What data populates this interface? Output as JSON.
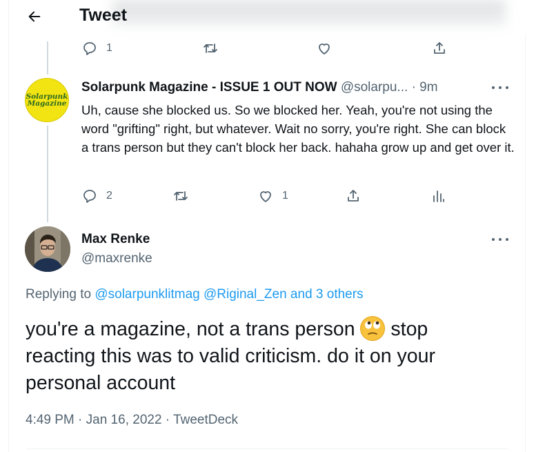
{
  "header": {
    "title": "Tweet",
    "back_icon": "arrow-left-icon"
  },
  "top_actions": {
    "reply_count": "1"
  },
  "reply_tweet": {
    "avatar_text_line1": "Solarpunk",
    "avatar_text_line2": "Magazine",
    "name": "Solarpunk Magazine - ISSUE 1 OUT NOW",
    "handle": "@solarpu...",
    "time": "· 9m",
    "text": "Uh, cause she blocked us. So we blocked her. Yeah, you're not using the word \"grifting\" right, but whatever. Wait no sorry, you're right. She can block a trans person but they can't block her back. hahaha grow up and get over it.",
    "reply_count": "2",
    "like_count": "1"
  },
  "main_tweet": {
    "name": "Max Renke",
    "handle": "@maxrenke",
    "replying_prefix": "Replying to",
    "replying_links": "@solarpunklitmag @Riginal_Zen and 3 others",
    "text_part1": "you're a magazine, not a trans person",
    "emoji": "face-with-rolling-eyes",
    "text_part2": "stop reacting this was to valid criticism. do it on your personal account",
    "timestamp": "4:49 PM · Jan 16, 2022 · TweetDeck"
  },
  "colors": {
    "link": "#1d9bf0",
    "muted": "#536471",
    "text": "#0f1419",
    "thread_line": "#cfd9de"
  }
}
